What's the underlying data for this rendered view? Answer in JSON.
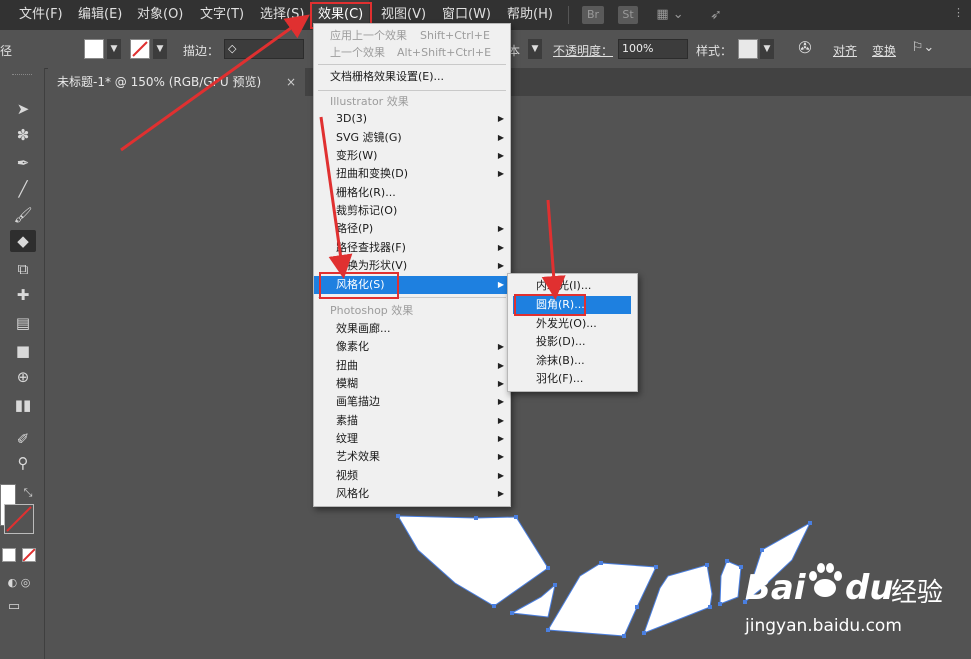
{
  "menubar": {
    "items": [
      "文件(F)",
      "编辑(E)",
      "对象(O)",
      "文字(T)",
      "选择(S)",
      "效果(C)",
      "视图(V)",
      "窗口(W)",
      "帮助(H)"
    ],
    "icons": [
      "Br",
      "St"
    ]
  },
  "options_bar": {
    "partial_label": "径",
    "stroke_label": "描边：",
    "opacity_partial": "本",
    "opacity_label": "不透明度：",
    "opacity_value": "100%",
    "style_label": "样式：",
    "align_label": "对齐",
    "transform_label": "变换"
  },
  "document_tab": {
    "title": "未标题-1* @ 150% (RGB/GPU 预览)",
    "close": "×"
  },
  "effect_menu": {
    "apply_last": {
      "label": "应用上一个效果",
      "shortcut": "Shift+Ctrl+E"
    },
    "last": {
      "label": "上一个效果",
      "shortcut": "Alt+Shift+Ctrl+E"
    },
    "raster_settings": "文档栅格效果设置(E)...",
    "illustrator_header": "Illustrator 效果",
    "illustrator_items": [
      "3D(3)",
      "SVG 滤镜(G)",
      "变形(W)",
      "扭曲和变换(D)",
      "栅格化(R)...",
      "裁剪标记(O)",
      "路径(P)",
      "路径查找器(F)",
      "转换为形状(V)",
      "风格化(S)"
    ],
    "photoshop_header": "Photoshop 效果",
    "photoshop_items": [
      "效果画廊...",
      "像素化",
      "扭曲",
      "模糊",
      "画笔描边",
      "素描",
      "纹理",
      "艺术效果",
      "视频",
      "风格化"
    ]
  },
  "stylize_submenu": {
    "items": [
      "内发光(I)...",
      "圆角(R)...",
      "外发光(O)...",
      "投影(D)...",
      "涂抹(B)...",
      "羽化(F)..."
    ],
    "highlighted": "圆角(R)..."
  },
  "watermark": {
    "brand_a": "Bai",
    "brand_b": "du",
    "brand_cn": "经验",
    "url": "jingyan.baidu.com"
  },
  "colors": {
    "menu_bg": "#f0f0f0",
    "highlight": "#1e80e0",
    "annotation_red": "#e03030",
    "canvas": "#535353",
    "shape_fill": "#ffffff",
    "anchor": "#4a7fe0"
  }
}
